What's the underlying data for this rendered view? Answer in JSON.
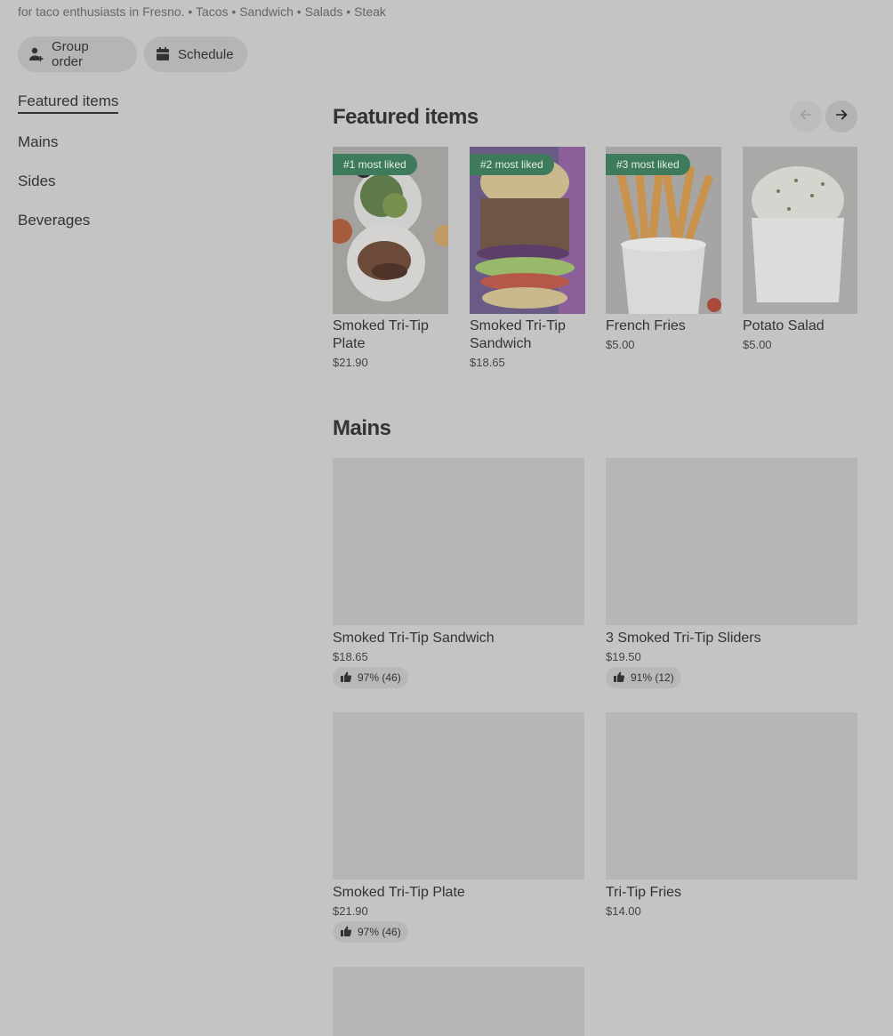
{
  "store": {
    "tagline": "for taco enthusiasts in Fresno. • Tacos • Sandwich • Salads • Steak"
  },
  "actions": {
    "group_order": "Group order",
    "schedule": "Schedule"
  },
  "nav": {
    "items": [
      "Featured items",
      "Mains",
      "Sides",
      "Beverages"
    ]
  },
  "featured": {
    "title": "Featured items",
    "items": [
      {
        "badge": "#1 most liked",
        "name": "Smoked Tri-Tip Plate",
        "price": "$21.90"
      },
      {
        "badge": "#2 most liked",
        "name": "Smoked Tri-Tip Sandwich",
        "price": "$18.65"
      },
      {
        "badge": "#3 most liked",
        "name": "French Fries",
        "price": "$5.00"
      },
      {
        "badge": "",
        "name": "Potato Salad",
        "price": "$5.00"
      }
    ]
  },
  "mains": {
    "title": "Mains",
    "items": [
      {
        "name": "Smoked Tri-Tip Sandwich",
        "price": "$18.65",
        "rating": "97% (46)"
      },
      {
        "name": "3 Smoked Tri-Tip Sliders",
        "price": "$19.50",
        "rating": "91% (12)"
      },
      {
        "name": "Smoked Tri-Tip Plate",
        "price": "$21.90",
        "rating": "97% (46)"
      },
      {
        "name": "Tri-Tip Fries",
        "price": "$14.00",
        "rating": ""
      }
    ]
  },
  "icons": {
    "group_order": "person-add-icon",
    "schedule": "calendar-icon",
    "prev": "arrow-left-icon",
    "next": "arrow-right-icon",
    "rating": "thumbs-up-icon"
  },
  "colors": {
    "badge": "#3e7a5c",
    "overlay_background": "#c4c4c4"
  }
}
